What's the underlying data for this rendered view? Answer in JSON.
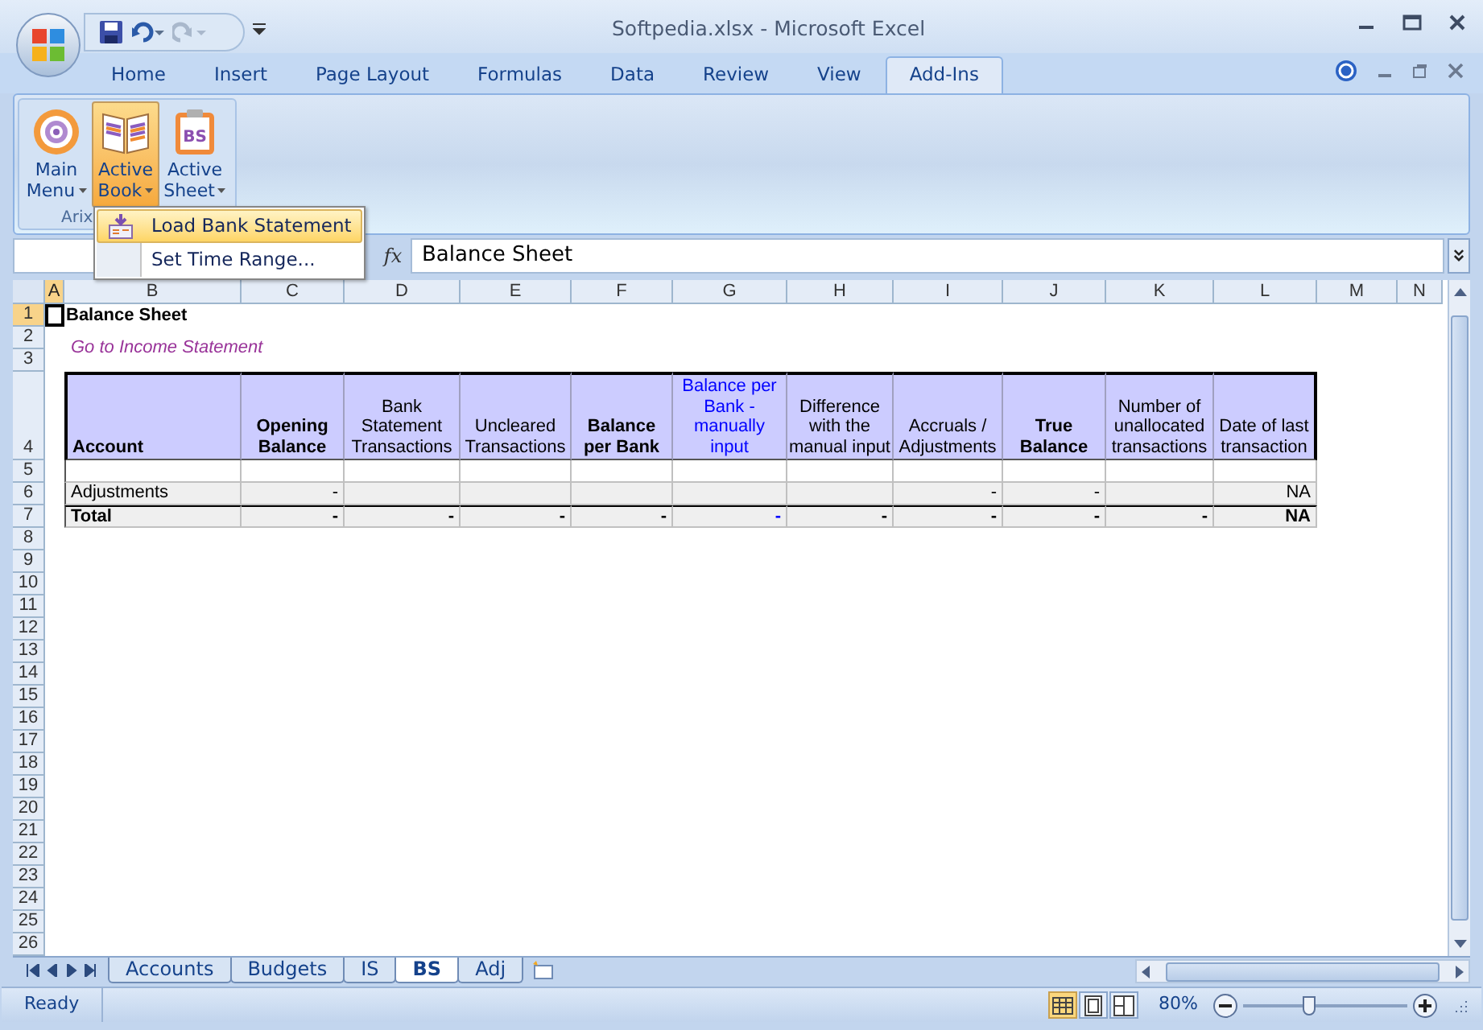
{
  "window": {
    "title": "Softpedia.xlsx - Microsoft Excel"
  },
  "quick_access": [
    {
      "kind": "save",
      "disabled": false
    },
    {
      "kind": "undo",
      "disabled": false
    },
    {
      "kind": "redo",
      "disabled": true
    }
  ],
  "tabs": [
    {
      "label": "Home",
      "selected": false
    },
    {
      "label": "Insert",
      "selected": false
    },
    {
      "label": "Page Layout",
      "selected": false
    },
    {
      "label": "Formulas",
      "selected": false
    },
    {
      "label": "Data",
      "selected": false
    },
    {
      "label": "Review",
      "selected": false
    },
    {
      "label": "View",
      "selected": false
    },
    {
      "label": "Add-Ins",
      "selected": true
    }
  ],
  "ribbon": {
    "group_label": "Arix",
    "buttons": [
      {
        "lines": [
          "Main",
          "Menu"
        ],
        "selected": false,
        "kind": "target"
      },
      {
        "lines": [
          "Active",
          "Book"
        ],
        "selected": true,
        "kind": "book"
      },
      {
        "lines": [
          "Active",
          "Sheet"
        ],
        "selected": false,
        "kind": "clipboard",
        "icon_text": "BS"
      }
    ]
  },
  "dropdown_menu": [
    {
      "label": "Load Bank Statement",
      "selected": true,
      "has_icon": true
    },
    {
      "label": "Set Time Range...",
      "selected": false,
      "has_icon": false
    }
  ],
  "formula_bar": {
    "fx": "fx",
    "value": "Balance Sheet"
  },
  "sheet": {
    "columns": [
      {
        "label": "A",
        "selected": true
      },
      {
        "label": "B",
        "selected": false
      },
      {
        "label": "C",
        "selected": false
      },
      {
        "label": "D",
        "selected": false
      },
      {
        "label": "E",
        "selected": false
      },
      {
        "label": "F",
        "selected": false
      },
      {
        "label": "G",
        "selected": false
      },
      {
        "label": "H",
        "selected": false
      },
      {
        "label": "I",
        "selected": false
      },
      {
        "label": "J",
        "selected": false
      },
      {
        "label": "K",
        "selected": false
      },
      {
        "label": "L",
        "selected": false
      },
      {
        "label": "M",
        "selected": false
      },
      {
        "label": "N",
        "selected": false
      }
    ],
    "rows": [
      {
        "label": "1",
        "selected": true
      },
      {
        "label": "2",
        "selected": false
      },
      {
        "label": "3",
        "selected": false
      },
      {
        "label": "4",
        "selected": false
      },
      {
        "label": "5",
        "selected": false
      },
      {
        "label": "6",
        "selected": false
      },
      {
        "label": "7",
        "selected": false
      },
      {
        "label": "8",
        "selected": false
      },
      {
        "label": "9",
        "selected": false
      },
      {
        "label": "10",
        "selected": false
      },
      {
        "label": "11",
        "selected": false
      },
      {
        "label": "12",
        "selected": false
      },
      {
        "label": "13",
        "selected": false
      },
      {
        "label": "14",
        "selected": false
      },
      {
        "label": "15",
        "selected": false
      },
      {
        "label": "16",
        "selected": false
      },
      {
        "label": "17",
        "selected": false
      },
      {
        "label": "18",
        "selected": false
      },
      {
        "label": "19",
        "selected": false
      },
      {
        "label": "20",
        "selected": false
      },
      {
        "label": "21",
        "selected": false
      },
      {
        "label": "22",
        "selected": false
      },
      {
        "label": "23",
        "selected": false
      },
      {
        "label": "24",
        "selected": false
      },
      {
        "label": "25",
        "selected": false
      },
      {
        "label": "26",
        "selected": false
      }
    ],
    "title": "Balance Sheet",
    "link": "Go to Income Statement",
    "table": {
      "headers": [
        {
          "lines": [
            "Account"
          ],
          "bold": true,
          "kind": "normal"
        },
        {
          "lines": [
            "Opening",
            "Balance"
          ],
          "bold": true,
          "kind": "normal"
        },
        {
          "lines": [
            "Bank",
            "Statement",
            "Transactions"
          ],
          "bold": false,
          "kind": "normal"
        },
        {
          "lines": [
            "Uncleared",
            "Transactions"
          ],
          "bold": false,
          "kind": "normal"
        },
        {
          "lines": [
            "Balance",
            "per Bank"
          ],
          "bold": true,
          "kind": "normal"
        },
        {
          "lines": [
            "Balance per",
            "Bank -",
            "manually",
            "input"
          ],
          "bold": false,
          "kind": "input"
        },
        {
          "lines": [
            "Difference",
            "with the",
            "manual input"
          ],
          "bold": false,
          "kind": "normal"
        },
        {
          "lines": [
            "Accruals /",
            "Adjustments"
          ],
          "bold": false,
          "kind": "normal"
        },
        {
          "lines": [
            "True",
            "Balance"
          ],
          "bold": true,
          "kind": "normal"
        },
        {
          "lines": [
            "Number of",
            "unallocated",
            "transactions"
          ],
          "bold": false,
          "kind": "normal"
        },
        {
          "lines": [
            "Date of last",
            "transaction"
          ],
          "bold": false,
          "kind": "normal"
        }
      ],
      "rows": [
        {
          "cells": [
            "Adjustments",
            "-",
            null,
            null,
            null,
            null,
            null,
            "-",
            "-",
            null,
            "NA"
          ],
          "bold": false,
          "total": false
        },
        {
          "cells": [
            "Total",
            "-",
            "-",
            "-",
            "-",
            "-",
            "-",
            "-",
            "-",
            "-",
            "NA"
          ],
          "bold": true,
          "total": true
        }
      ]
    }
  },
  "sheet_tabs": [
    {
      "label": "Accounts",
      "selected": false
    },
    {
      "label": "Budgets",
      "selected": false
    },
    {
      "label": "IS",
      "selected": false
    },
    {
      "label": "BS",
      "selected": true
    },
    {
      "label": "Adj",
      "selected": false
    }
  ],
  "status_bar": {
    "status": "Ready",
    "view_buttons": [
      {
        "kind": "normal",
        "selected": true
      },
      {
        "kind": "page_layout",
        "selected": false
      },
      {
        "kind": "page_break",
        "selected": false
      }
    ],
    "zoom": {
      "label": "80%",
      "level": 0.4
    }
  }
}
